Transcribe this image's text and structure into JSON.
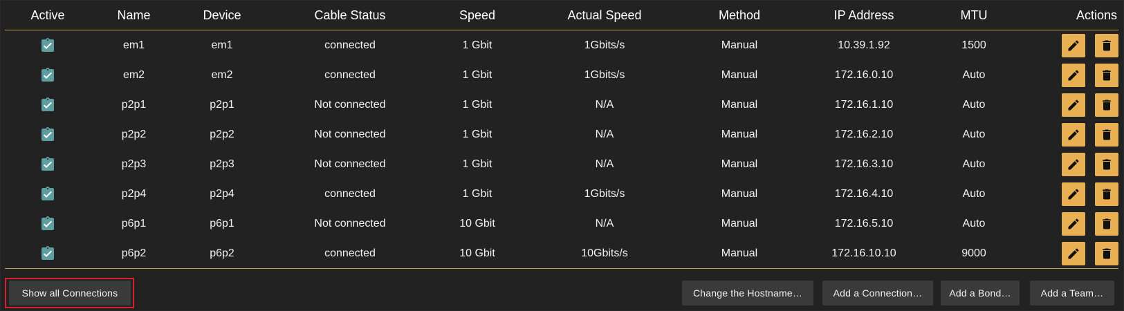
{
  "columns": [
    "Active",
    "Name",
    "Device",
    "Cable Status",
    "Speed",
    "Actual Speed",
    "Method",
    "IP Address",
    "MTU",
    "Actions"
  ],
  "rows": [
    {
      "name": "em1",
      "device": "em1",
      "cable_status": "connected",
      "speed": "1 Gbit",
      "actual_speed": "1Gbits/s",
      "method": "Manual",
      "ip": "10.39.1.92",
      "mtu": "1500"
    },
    {
      "name": "em2",
      "device": "em2",
      "cable_status": "connected",
      "speed": "1 Gbit",
      "actual_speed": "1Gbits/s",
      "method": "Manual",
      "ip": "172.16.0.10",
      "mtu": "Auto"
    },
    {
      "name": "p2p1",
      "device": "p2p1",
      "cable_status": "Not connected",
      "speed": "1 Gbit",
      "actual_speed": "N/A",
      "method": "Manual",
      "ip": "172.16.1.10",
      "mtu": "Auto"
    },
    {
      "name": "p2p2",
      "device": "p2p2",
      "cable_status": "Not connected",
      "speed": "1 Gbit",
      "actual_speed": "N/A",
      "method": "Manual",
      "ip": "172.16.2.10",
      "mtu": "Auto"
    },
    {
      "name": "p2p3",
      "device": "p2p3",
      "cable_status": "Not connected",
      "speed": "1 Gbit",
      "actual_speed": "N/A",
      "method": "Manual",
      "ip": "172.16.3.10",
      "mtu": "Auto"
    },
    {
      "name": "p2p4",
      "device": "p2p4",
      "cable_status": "connected",
      "speed": "1 Gbit",
      "actual_speed": "1Gbits/s",
      "method": "Manual",
      "ip": "172.16.4.10",
      "mtu": "Auto"
    },
    {
      "name": "p6p1",
      "device": "p6p1",
      "cable_status": "Not connected",
      "speed": "10 Gbit",
      "actual_speed": "N/A",
      "method": "Manual",
      "ip": "172.16.5.10",
      "mtu": "Auto"
    },
    {
      "name": "p6p2",
      "device": "p6p2",
      "cable_status": "connected",
      "speed": "10 Gbit",
      "actual_speed": "10Gbits/s",
      "method": "Manual",
      "ip": "172.16.10.10",
      "mtu": "9000"
    }
  ],
  "row_icons": {
    "active": "clipboard-check-icon",
    "edit": "pencil-icon",
    "delete": "trash-icon"
  },
  "buttons": {
    "show_all": "Show all Connections",
    "change_hostname": "Change the Hostname…",
    "add_connection": "Add a Connection…",
    "add_bond": "Add a Bond…",
    "add_team": "Add a Team…"
  },
  "colors": {
    "background": "#222222",
    "accent": "#e8b052",
    "active_icon": "#5f9ea0",
    "divider": "#c9a050",
    "highlight_outline": "#d4212a",
    "button_bg": "#3a3a3a"
  }
}
